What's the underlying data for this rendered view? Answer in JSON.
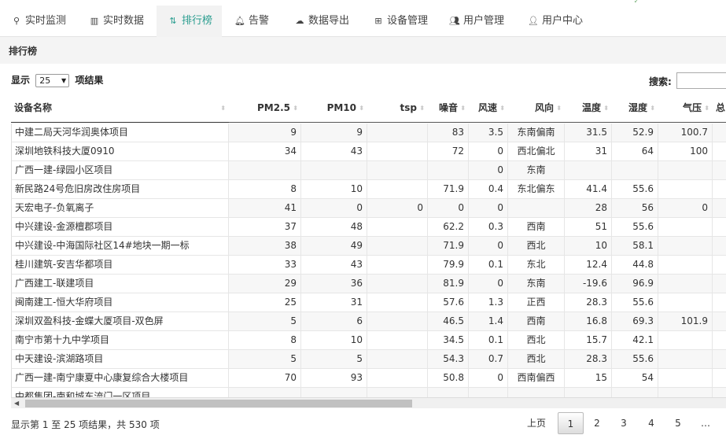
{
  "nav": {
    "items": [
      {
        "label": "实时监测",
        "icon": "map-marker-icon",
        "glyph": "⚲"
      },
      {
        "label": "实时数据",
        "icon": "bar-chart-icon",
        "glyph": "▥"
      },
      {
        "label": "排行榜",
        "icon": "sort-amount-icon",
        "glyph": "⇅"
      },
      {
        "label": "告警",
        "icon": "bell-icon",
        "glyph": "🔔︎"
      },
      {
        "label": "数据导出",
        "icon": "cloud-download-icon",
        "glyph": "☁"
      },
      {
        "label": "设备管理",
        "icon": "sitemap-icon",
        "glyph": "⊞"
      },
      {
        "label": "用户管理",
        "icon": "users-icon",
        "glyph": "👥︎"
      },
      {
        "label": "用户中心",
        "icon": "user-icon",
        "glyph": "👤︎"
      }
    ],
    "active_index": 2
  },
  "page": {
    "title": "排行榜"
  },
  "length": {
    "prefix": "显示",
    "value": "25",
    "suffix": "项结果"
  },
  "search": {
    "label": "搜索:",
    "value": ""
  },
  "table": {
    "columns": [
      "设备名称",
      "PM2.5",
      "PM10",
      "tsp",
      "噪音",
      "风速",
      "风向",
      "温度",
      "湿度",
      "气压",
      "总"
    ],
    "rows": [
      [
        "中建二局天河华润奥体项目",
        "9",
        "9",
        "",
        "83",
        "3.5",
        "东南偏南",
        "31.5",
        "52.9",
        "100.7"
      ],
      [
        "深圳地铁科技大厦0910",
        "34",
        "43",
        "",
        "72",
        "0",
        "西北偏北",
        "31",
        "64",
        "100"
      ],
      [
        "广西一建-绿园小区项目",
        "",
        "",
        "",
        "",
        "0",
        "东南",
        "",
        "",
        ""
      ],
      [
        "新民路24号危旧房改住房项目",
        "8",
        "10",
        "",
        "71.9",
        "0.4",
        "东北偏东",
        "41.4",
        "55.6",
        ""
      ],
      [
        "天宏电子-负氧离子",
        "41",
        "0",
        "0",
        "0",
        "0",
        "",
        "28",
        "56",
        "0"
      ],
      [
        "中兴建设-金源檀郡项目",
        "37",
        "48",
        "",
        "62.2",
        "0.3",
        "西南",
        "51",
        "55.6",
        ""
      ],
      [
        "中兴建设-中海国际社区14#地块一期一标",
        "38",
        "49",
        "",
        "71.9",
        "0",
        "西北",
        "10",
        "58.1",
        ""
      ],
      [
        "桂川建筑-安吉华都项目",
        "33",
        "43",
        "",
        "79.9",
        "0.1",
        "东北",
        "12.4",
        "44.8",
        ""
      ],
      [
        "广西建工-联建项目",
        "29",
        "36",
        "",
        "81.9",
        "0",
        "东南",
        "-19.6",
        "96.9",
        ""
      ],
      [
        "闽南建工-恒大华府项目",
        "25",
        "31",
        "",
        "57.6",
        "1.3",
        "正西",
        "28.3",
        "55.6",
        ""
      ],
      [
        "深圳双盈科技-金蝶大厦项目-双色屏",
        "5",
        "6",
        "",
        "46.5",
        "1.4",
        "西南",
        "16.8",
        "69.3",
        "101.9"
      ],
      [
        "南宁市第十九中学项目",
        "8",
        "10",
        "",
        "34.5",
        "0.1",
        "西北",
        "15.7",
        "42.1",
        ""
      ],
      [
        "中天建设-滨湖路项目",
        "5",
        "5",
        "",
        "54.3",
        "0.7",
        "西北",
        "28.3",
        "55.6",
        ""
      ],
      [
        "广西一建-南宁康夏中心康复综合大楼项目",
        "70",
        "93",
        "",
        "50.8",
        "0",
        "西南偏西",
        "15",
        "54",
        ""
      ],
      [
        "中都集团-南和城东流门一区项目",
        "",
        "",
        "",
        "",
        "",
        "",
        "",
        "",
        ""
      ]
    ]
  },
  "footer": {
    "info": "显示第 1 至 25 项结果，共 530 项",
    "prev": "上页",
    "pages": [
      "1",
      "2",
      "3",
      "4",
      "5",
      "…"
    ],
    "current_index": 0
  }
}
